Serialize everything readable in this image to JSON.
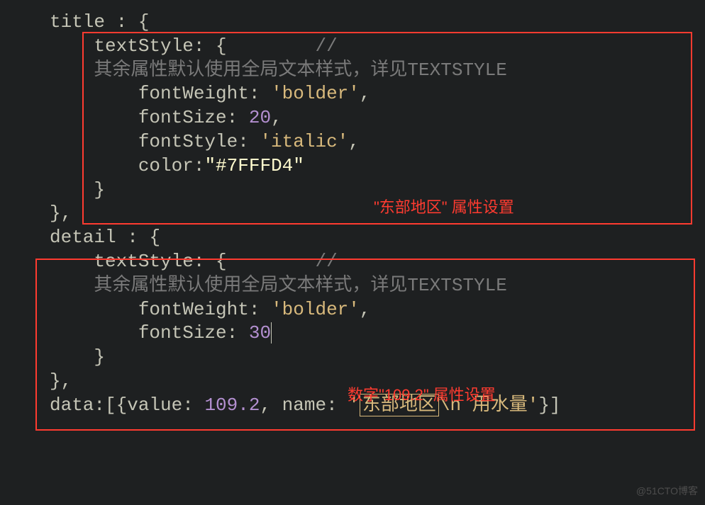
{
  "code": {
    "line1_a": "title : ",
    "line1_b": "{",
    "line2_a": "    textStyle: ",
    "line2_b": "{",
    "line2_c": "        //",
    "line3": "    其余属性默认使用全局文本样式，详见TEXTSTYLE",
    "line4_a": "        fontWeight: ",
    "line4_b": "'bolder'",
    "line4_c": ",",
    "line5_a": "        fontSize: ",
    "line5_b": "20",
    "line5_c": ",",
    "line6_a": "        fontStyle: ",
    "line6_b": "'italic'",
    "line6_c": ",",
    "line7_a": "        color:",
    "line7_b": "\"#7FFFD4\"",
    "line8": "    }",
    "line9": "},",
    "line10_a": "detail : ",
    "line10_b": "{",
    "line11_a": "    textStyle: ",
    "line11_b": "{",
    "line11_c": "        //",
    "line12": "    其余属性默认使用全局文本样式，详见TEXTSTYLE",
    "line13_a": "        fontWeight: ",
    "line13_b": "'bolder'",
    "line13_c": ",",
    "line14_a": "        fontSize: ",
    "line14_b": "30",
    "line15": "    }",
    "line16": "},",
    "line17_a": "data:[{value: ",
    "line17_b": "109.2",
    "line17_c": ", name: ",
    "line17_d": "'",
    "line17_e": "东部地区",
    "line17_f": "\\n 用水量'",
    "line17_g": "}]"
  },
  "annotations": {
    "box1_label": "\"东部地区\" 属性设置",
    "box2_label": "数字\"109.2\" 属性设置"
  },
  "watermark": "@51CTO博客"
}
